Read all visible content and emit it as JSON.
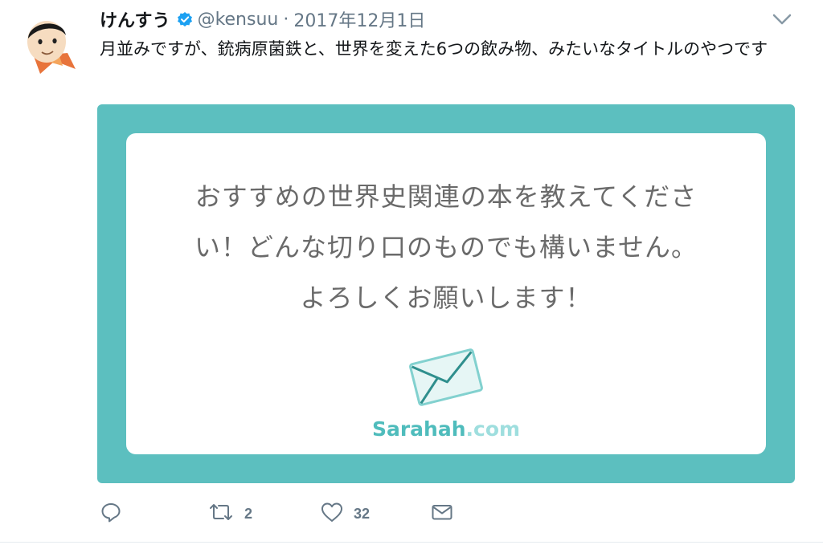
{
  "author": {
    "name": "けんすう",
    "handle": "@kensuu",
    "date": "2017年12月1日"
  },
  "icons": {
    "avatar": "avatar-illustration",
    "verified": "verified-badge-icon",
    "caret": "chevron-down-icon"
  },
  "tweet": {
    "text": "月並みですが、銃病原菌鉄と、世界を変えた6つの飲み物、みたいなタイトルのやつです"
  },
  "card": {
    "lines": [
      "おすすめの世界史関連の本を教えてくださ",
      "い！どんな切り口のものでも構いません。",
      "よろしくお願いします！"
    ],
    "brand_main": "Sarahah",
    "brand_tld": ".com",
    "background_color": "#5cbfbf"
  },
  "actions": {
    "reply_icon": "reply-icon",
    "retweet_icon": "retweet-icon",
    "retweet_count": "2",
    "like_icon": "heart-icon",
    "like_count": "32",
    "dm_icon": "envelope-icon"
  }
}
